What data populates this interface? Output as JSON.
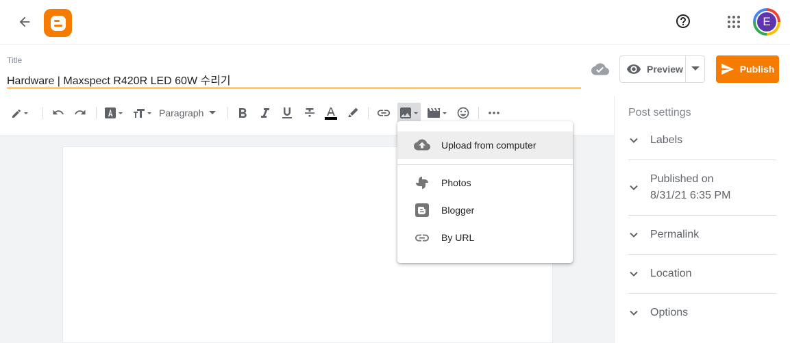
{
  "topbar": {
    "back_icon": "arrow-back-icon",
    "logo_icon": "blogger-logo-icon",
    "help_icon": "help-circle-icon",
    "apps_icon": "apps-grid-icon",
    "avatar_initial": "E"
  },
  "title": {
    "label": "Title",
    "value": "Hardware | Maxspect R420R LED 60W 수리기"
  },
  "actions": {
    "preview_label": "Preview",
    "publish_label": "Publish",
    "brand_color": "#f57c00"
  },
  "toolbar": {
    "paragraph_label": "Paragraph",
    "icons": [
      "pencil-icon",
      "undo-icon",
      "redo-icon",
      "font-icon",
      "text-size-icon",
      "bold-icon",
      "italic-icon",
      "underline-icon",
      "strikethrough-icon",
      "text-color-icon",
      "highlight-icon",
      "link-icon",
      "image-icon",
      "video-icon",
      "emoji-icon",
      "more-icon"
    ]
  },
  "image_menu": {
    "items": [
      {
        "label": "Upload from computer",
        "icon": "cloud-upload-icon"
      },
      {
        "label": "Photos",
        "icon": "photos-pinwheel-icon"
      },
      {
        "label": "Blogger",
        "icon": "blogger-icon"
      },
      {
        "label": "By URL",
        "icon": "link-icon"
      }
    ]
  },
  "sidebar": {
    "heading": "Post settings",
    "items": [
      {
        "label": "Labels"
      },
      {
        "label": "Published on",
        "sub": "8/31/21 6:35 PM"
      },
      {
        "label": "Permalink"
      },
      {
        "label": "Location"
      },
      {
        "label": "Options"
      }
    ]
  }
}
